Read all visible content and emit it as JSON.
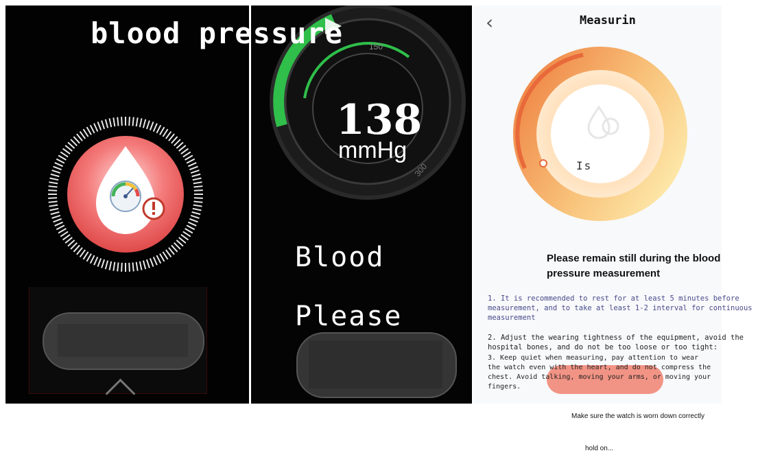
{
  "panel1": {
    "title": "blood pressure"
  },
  "panel2": {
    "reading_value": "138",
    "reading_unit": "mmHg",
    "dial_ticks": [
      "150",
      "300"
    ],
    "text_line1": "Blood",
    "text_line2": "Please"
  },
  "panel3": {
    "title": "Measurin",
    "timer": "Is",
    "heading": "Please remain still during the blood pressure measurement",
    "tip1": "1. It is recommended to rest for at least 5 minutes before measurement, and to take at least 1-2 interval for continuous measurement",
    "tip2": "2. Adjust the wearing tightness of the equipment, avoid the hospital bones, and do not be too loose or too tight:",
    "tip3": "3. Keep quiet when measuring, pay attention to wear the watch even with the heart, and do not compress the chest. Avoid talking, moving your arms, or moving your fingers."
  },
  "footer": {
    "note1": "Make sure the watch is worn down correctly",
    "note2": "hold on..."
  },
  "colors": {
    "accent_green": "#2fbf4a",
    "alert_red": "#e85a5a",
    "orange_gradient_start": "#f08a4a",
    "orange_gradient_end": "#fde7a8",
    "button_red": "#f06c58"
  }
}
